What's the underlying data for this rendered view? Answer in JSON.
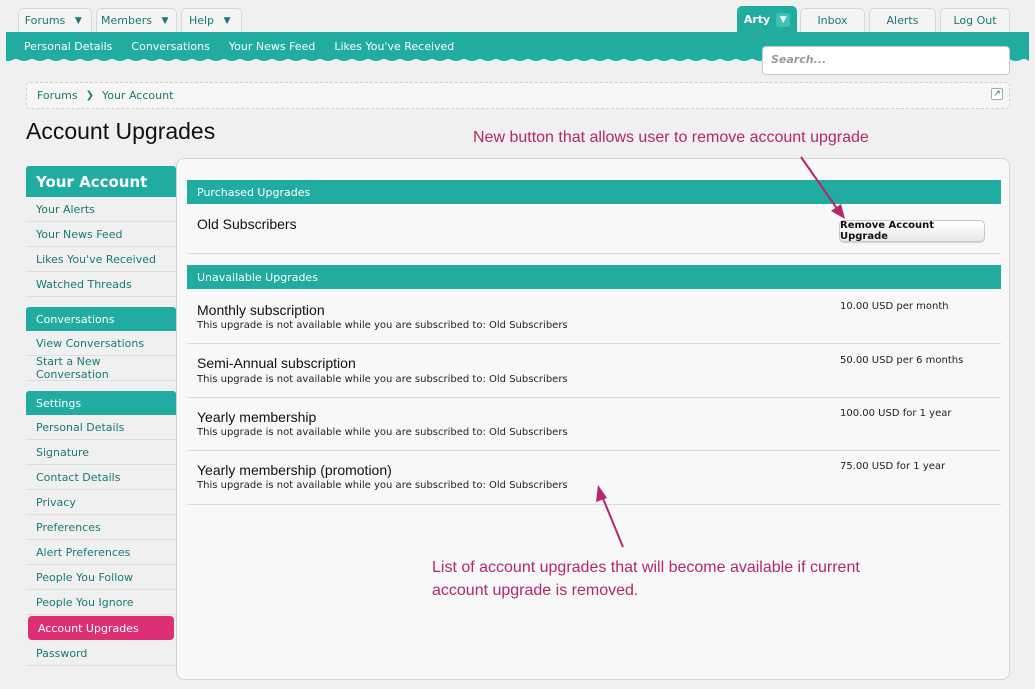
{
  "nav": {
    "left_tabs": [
      {
        "label": "Forums"
      },
      {
        "label": "Members"
      },
      {
        "label": "Help"
      }
    ],
    "user_tab": {
      "label": "Arty"
    },
    "right_tabs": [
      {
        "label": "Inbox"
      },
      {
        "label": "Alerts"
      },
      {
        "label": "Log Out"
      }
    ],
    "sub_links": [
      "Personal Details",
      "Conversations",
      "Your News Feed",
      "Likes You've Received"
    ],
    "search_placeholder": "Search..."
  },
  "breadcrumb": [
    "Forums",
    "Your Account"
  ],
  "page_title": "Account Upgrades",
  "sidebar": {
    "heading": "Your Account",
    "main_items": [
      "Your Alerts",
      "Your News Feed",
      "Likes You've Received",
      "Watched Threads"
    ],
    "conversations_heading": "Conversations",
    "conversation_items": [
      "View Conversations",
      "Start a New Conversation"
    ],
    "settings_heading": "Settings",
    "settings_items": [
      "Personal Details",
      "Signature",
      "Contact Details",
      "Privacy",
      "Preferences",
      "Alert Preferences",
      "People You Follow",
      "People You Ignore",
      "Account Upgrades",
      "Password"
    ],
    "selected": "Account Upgrades"
  },
  "purchased": {
    "heading": "Purchased Upgrades",
    "title": "Old Subscribers",
    "button": "Remove Account Upgrade"
  },
  "unavailable": {
    "heading": "Unavailable Upgrades",
    "items": [
      {
        "title": "Monthly subscription",
        "note": "This upgrade is not available while you are subscribed to: Old Subscribers",
        "cost": "10.00 USD per month"
      },
      {
        "title": "Semi-Annual subscription",
        "note": "This upgrade is not available while you are subscribed to: Old Subscribers",
        "cost": "50.00 USD per 6 months"
      },
      {
        "title": "Yearly membership",
        "note": "This upgrade is not available while you are subscribed to: Old Subscribers",
        "cost": "100.00 USD for 1 year"
      },
      {
        "title": "Yearly membership (promotion)",
        "note": "This upgrade is not available while you are subscribed to: Old Subscribers",
        "cost": "75.00 USD for 1 year"
      }
    ]
  },
  "annotations": {
    "top": "New button that allows user to remove account upgrade",
    "bottom_line1": "List of account upgrades that will become available if current",
    "bottom_line2": "account upgrade is removed."
  },
  "colors": {
    "accent": "#20aca0",
    "selected": "#dd2f76",
    "annotation": "#b5276b"
  }
}
